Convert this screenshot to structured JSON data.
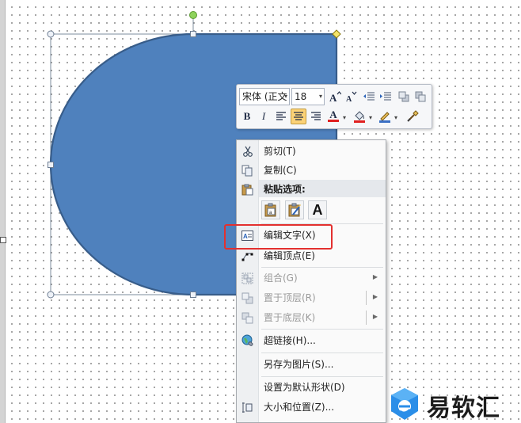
{
  "mini_toolbar": {
    "font_name": "宋体 (正文",
    "font_size": "18",
    "row1_buttons": [
      "grow-font",
      "shrink-font",
      "decrease-indent",
      "increase-indent",
      "bring-forward",
      "send-backward"
    ],
    "bold": "B",
    "italic": "I",
    "font_color_glyph": "A",
    "font_color": "#e02020",
    "fill_color": "#e02020"
  },
  "context_menu": {
    "cut": "剪切(T)",
    "copy": "复制(C)",
    "paste_options_label": "粘贴选项:",
    "paste_text_only": "A",
    "edit_text": "编辑文字(X)",
    "edit_points": "编辑顶点(E)",
    "group": "组合(G)",
    "bring_to_front": "置于顶层(R)",
    "send_to_back": "置于底层(K)",
    "hyperlink": "超链接(H)...",
    "save_as_picture": "另存为图片(S)...",
    "set_default_shape": "设置为默认形状(D)",
    "size_position": "大小和位置(Z)..."
  },
  "shape": {
    "fill": "#4f81bd",
    "stroke": "#385d8a"
  },
  "watermark": {
    "text": "易软汇"
  },
  "colors": {
    "highlight": "#e3302f",
    "menu_hover": "#fbd277"
  }
}
